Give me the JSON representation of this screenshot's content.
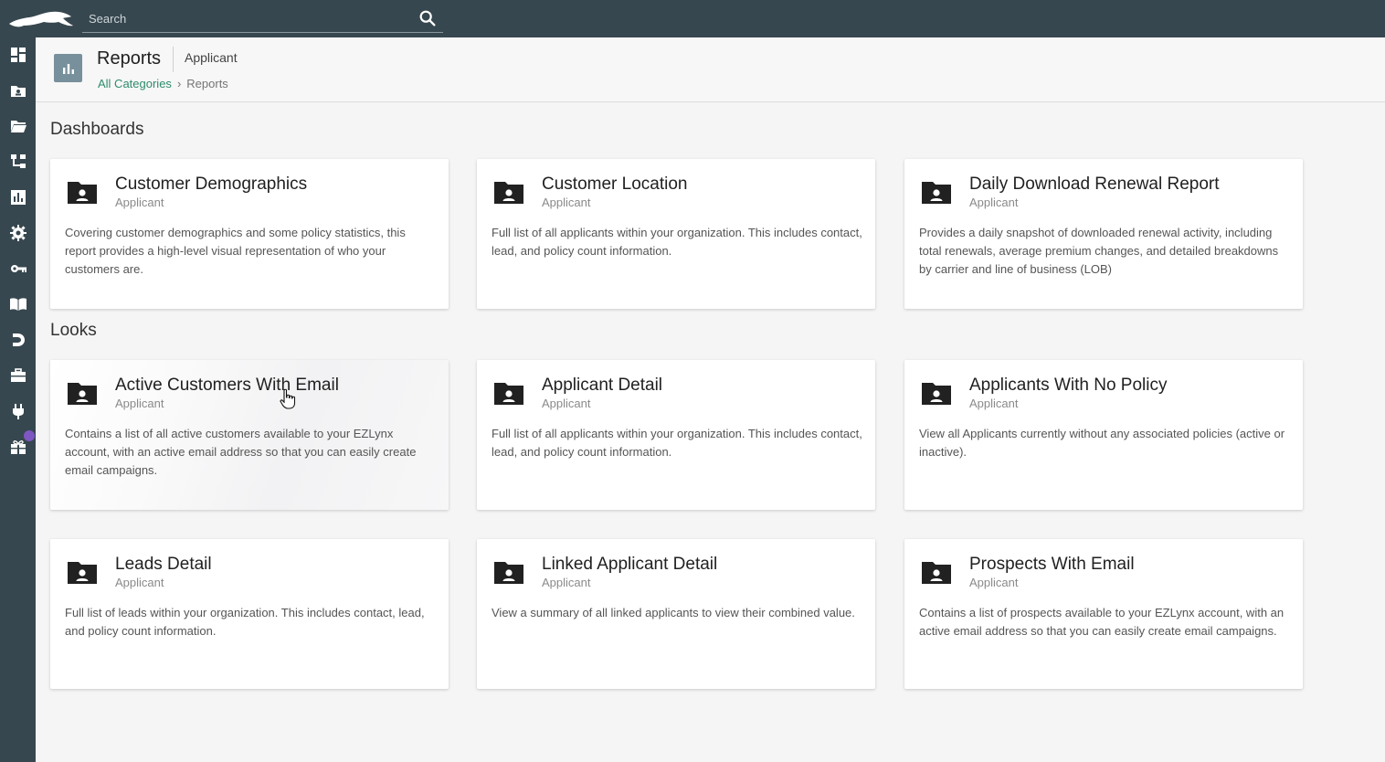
{
  "search": {
    "placeholder": "Search"
  },
  "header": {
    "title": "Reports",
    "context": "Applicant",
    "breadcrumb": {
      "link": "All Categories",
      "separator": "›",
      "current": "Reports"
    }
  },
  "nav": {
    "items": [
      {
        "name": "dashboard-icon"
      },
      {
        "name": "contacts-folder-icon"
      },
      {
        "name": "open-folder-icon"
      },
      {
        "name": "hierarchy-icon"
      },
      {
        "name": "reports-icon"
      },
      {
        "name": "settings-gear-icon"
      },
      {
        "name": "key-icon"
      },
      {
        "name": "book-icon"
      },
      {
        "name": "magnet-icon"
      },
      {
        "name": "briefcase-icon"
      },
      {
        "name": "plug-icon"
      },
      {
        "name": "gift-icon"
      }
    ]
  },
  "sections": {
    "dashboards": "Dashboards",
    "looks": "Looks"
  },
  "dashboards": [
    {
      "title": "Customer Demographics",
      "subtitle": "Applicant",
      "description": "Covering customer demographics and some policy statistics, this report provides a high-level visual representation of who your customers are."
    },
    {
      "title": "Customer Location",
      "subtitle": "Applicant",
      "description": "Full list of all applicants within your organization. This includes contact, lead, and policy count information."
    },
    {
      "title": "Daily Download Renewal Report",
      "subtitle": "Applicant",
      "description": "Provides a daily snapshot of downloaded renewal activity, including total renewals, average premium changes, and detailed breakdowns by carrier and line of business (LOB)"
    }
  ],
  "looks": [
    {
      "title": "Active Customers With Email",
      "subtitle": "Applicant",
      "description": "Contains a list of all active customers available to your EZLynx account, with an active email address so that you can easily create email campaigns."
    },
    {
      "title": "Applicant Detail",
      "subtitle": "Applicant",
      "description": "Full list of all applicants within your organization. This includes contact, lead, and policy count information."
    },
    {
      "title": "Applicants With No Policy",
      "subtitle": "Applicant",
      "description": "View all Applicants currently without any associated policies (active or inactive)."
    },
    {
      "title": "Leads Detail",
      "subtitle": "Applicant",
      "description": "Full list of leads within your organization. This includes contact, lead, and policy count information."
    },
    {
      "title": "Linked Applicant Detail",
      "subtitle": "Applicant",
      "description": "View a summary of all linked applicants to view their combined value."
    },
    {
      "title": "Prospects With Email",
      "subtitle": "Applicant",
      "description": "Contains a list of prospects available to your EZLynx account, with an active email address so that you can easily create email campaigns."
    }
  ],
  "colors": {
    "topbar": "#37474f",
    "accent_link": "#2e8b6e",
    "header_icon_bg": "#78909c"
  }
}
